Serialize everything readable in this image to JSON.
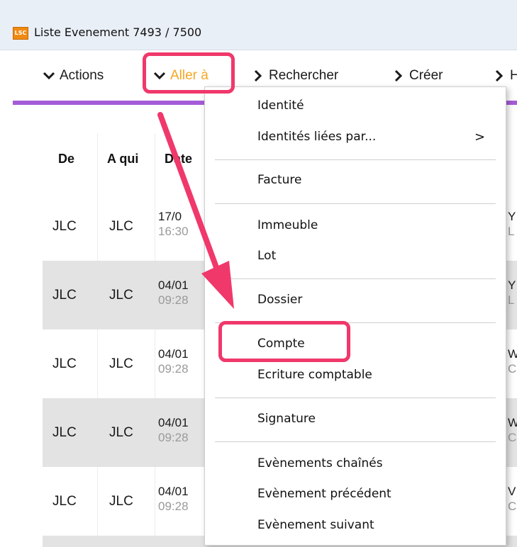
{
  "window": {
    "logo_text": "LSC",
    "title": "Liste  Evenement 7493 / 7500"
  },
  "toolbar": {
    "items": [
      {
        "label": "Actions"
      },
      {
        "label": "Aller à"
      },
      {
        "label": "Rechercher"
      },
      {
        "label": "Créer"
      },
      {
        "label": "H"
      }
    ]
  },
  "table": {
    "columns": [
      "De",
      "A qui",
      "Date"
    ],
    "rows": [
      {
        "de": "JLC",
        "a_qui": "JLC",
        "date": "17/0",
        "time": "16:30",
        "col_r1": "Y",
        "col_r2": "L"
      },
      {
        "de": "JLC",
        "a_qui": "JLC",
        "date": "04/01",
        "time": "09:28",
        "col_r1": "Y",
        "col_r2": "L"
      },
      {
        "de": "JLC",
        "a_qui": "JLC",
        "date": "04/01",
        "time": "09:28",
        "col_r1": "W",
        "col_r2": "C"
      },
      {
        "de": "JLC",
        "a_qui": "JLC",
        "date": "04/01",
        "time": "09:28",
        "col_r1": "W",
        "col_r2": "C"
      },
      {
        "de": "JLC",
        "a_qui": "JLC",
        "date": "04/01",
        "time": "09:28",
        "col_r1": "V",
        "col_r2": "C"
      }
    ]
  },
  "menu": {
    "items": [
      "Identité",
      "Identités liées par...",
      "Facture",
      "Immeuble",
      "Lot",
      "Dossier",
      "Compte",
      "Ecriture comptable",
      "Signature",
      "Evènements chaînés",
      "Evènement précédent",
      "Evènement suivant"
    ],
    "submenu_indicator": ">",
    "highlighted_item": "Compte"
  },
  "colors": {
    "accent_purple": "#a45cd8",
    "active_orange": "#f5a623",
    "highlight_pink": "#f0386b",
    "row_alt": "#e3e3e3"
  }
}
